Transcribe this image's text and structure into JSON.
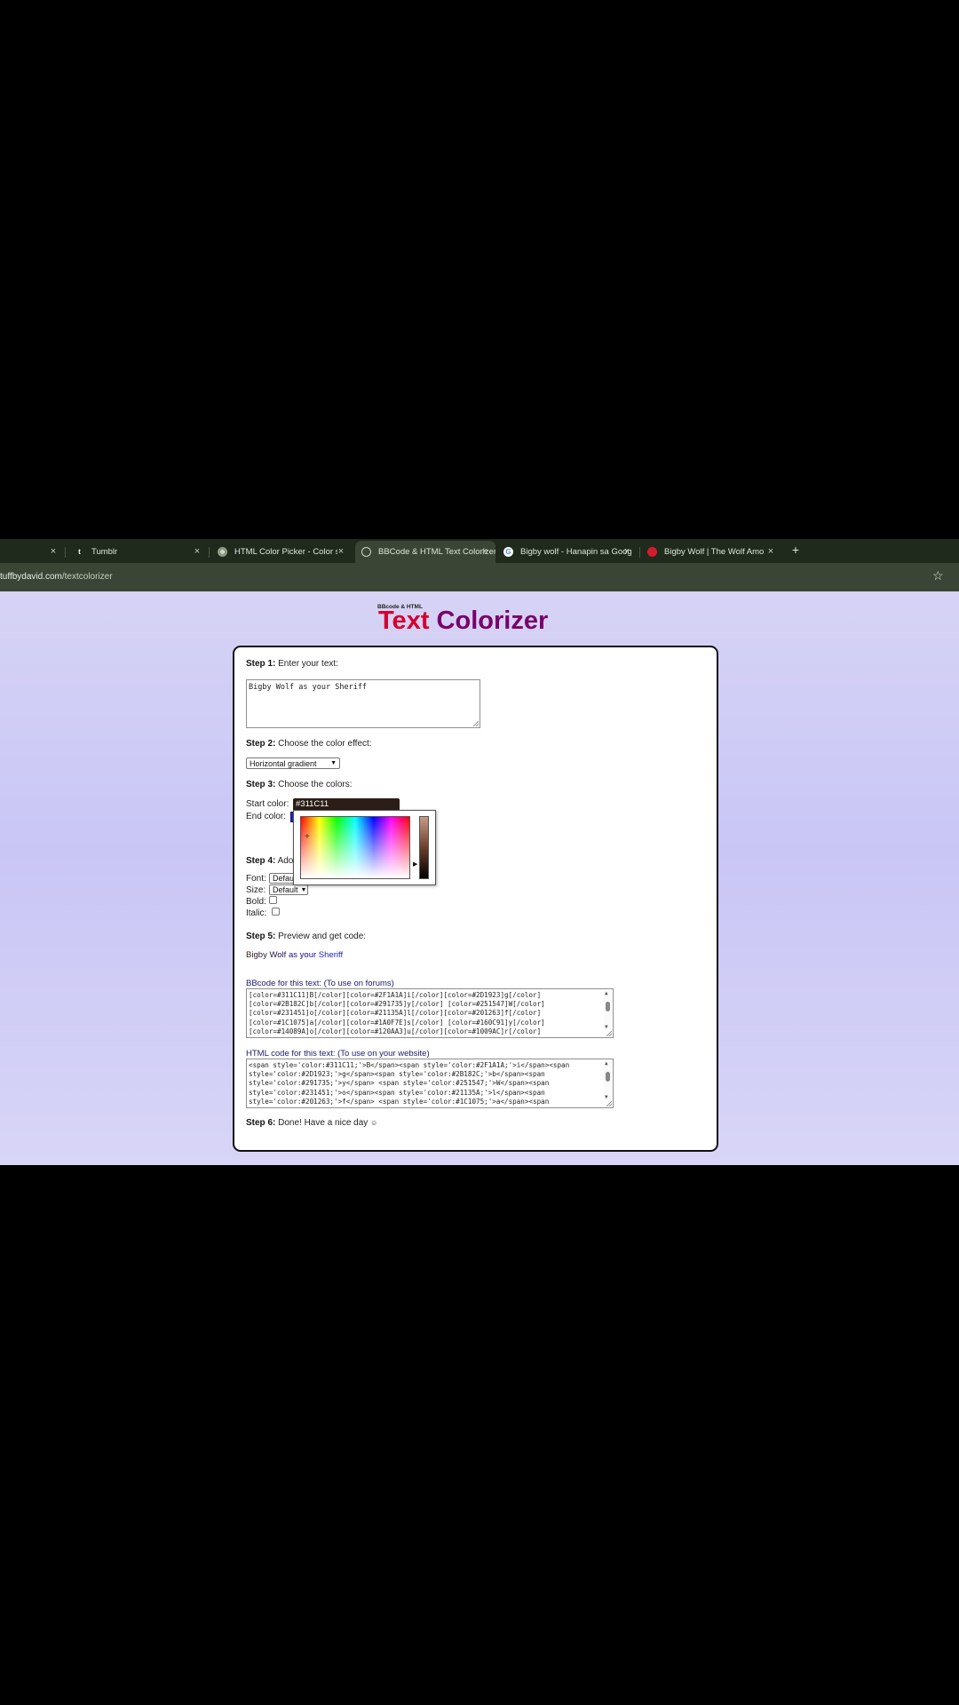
{
  "browser": {
    "tabs": [
      {
        "title": "",
        "favicon": "",
        "active": false
      },
      {
        "title": "Tumblr",
        "favicon": "tumblr-icon",
        "active": false
      },
      {
        "title": "HTML Color Picker - Color selec",
        "favicon": "colorpicker-icon",
        "active": false
      },
      {
        "title": "BBCode & HTML Text Colorizer",
        "favicon": "globe-icon",
        "active": true
      },
      {
        "title": "Bigby wolf - Hanapin sa Google",
        "favicon": "google-icon",
        "active": false
      },
      {
        "title": "Bigby Wolf | The Wolf Among U",
        "favicon": "fandom-icon",
        "active": false
      }
    ],
    "close_glyph": "×",
    "new_tab_glyph": "+",
    "url_host": "tuffbydavid.com",
    "url_path": "/textcolorizer",
    "star_glyph": "☆"
  },
  "logo": {
    "small": "BBcode & HTML",
    "word1": "Text",
    "word2": "Colorizer"
  },
  "step1": {
    "label": "Step 1:",
    "text": "Enter your text:",
    "value": "Bigby Wolf as your Sheriff"
  },
  "step2": {
    "label": "Step 2:",
    "text": "Choose the color effect:",
    "selected": "Horizontal gradient"
  },
  "step3": {
    "label": "Step 3:",
    "text": "Choose the colors:",
    "start_label": "Start color:",
    "start_value": "#311C11",
    "end_label": "End color:",
    "end_value_color": "#1F2AC0"
  },
  "step4": {
    "label": "Step 4:",
    "text": "Ado",
    "font_label": "Font:",
    "font_value": "Defau",
    "size_label": "Size:",
    "size_value": "Default",
    "bold_label": "Bold:",
    "italic_label": "Italic:"
  },
  "step5": {
    "label": "Step 5:",
    "text": "Preview and get code:",
    "preview_chars": [
      {
        "c": "B",
        "color": "#311C11"
      },
      {
        "c": "i",
        "color": "#2F1A1A"
      },
      {
        "c": "g",
        "color": "#2D1923"
      },
      {
        "c": "b",
        "color": "#2B182C"
      },
      {
        "c": "y",
        "color": "#291735"
      },
      {
        "c": " ",
        "color": "#291735"
      },
      {
        "c": "W",
        "color": "#251547"
      },
      {
        "c": "o",
        "color": "#231451"
      },
      {
        "c": "l",
        "color": "#21135A"
      },
      {
        "c": "f",
        "color": "#201263"
      },
      {
        "c": " ",
        "color": "#201263"
      },
      {
        "c": "a",
        "color": "#1C1075"
      },
      {
        "c": "s",
        "color": "#1A0F7E"
      },
      {
        "c": " ",
        "color": "#1A0F7E"
      },
      {
        "c": "y",
        "color": "#160C91"
      },
      {
        "c": "o",
        "color": "#14089A"
      },
      {
        "c": "u",
        "color": "#120AA3"
      },
      {
        "c": "r",
        "color": "#1009AC"
      },
      {
        "c": " ",
        "color": "#1009AC"
      },
      {
        "c": "S",
        "color": "#1A1FB5"
      },
      {
        "c": "h",
        "color": "#1C22B8"
      },
      {
        "c": "e",
        "color": "#1D24BA"
      },
      {
        "c": "r",
        "color": "#1E26BC"
      },
      {
        "c": "i",
        "color": "#1F28BE"
      },
      {
        "c": "f",
        "color": "#1F29BF"
      },
      {
        "c": "f",
        "color": "#1F2AC0"
      }
    ]
  },
  "bbcode": {
    "label": "BBcode for this text: (To use on forums)",
    "lines": [
      "[color=#311C11]B[/color][color=#2F1A1A]i[/color][color=#2D1923]g[/color]",
      "[color=#2B182C]b[/color][color=#291735]y[/color] [color=#251547]W[/color]",
      "[color=#231451]o[/color][color=#21135A]l[/color][color=#201263]f[/color]",
      "[color=#1C1075]a[/color][color=#1A0F7E]s[/color] [color=#160C91]y[/color]",
      "[color=#14089A]o[/color][color=#120AA3]u[/color][color=#1009AC]r[/color]"
    ]
  },
  "html_code": {
    "label": "HTML code for this text: (To use on your website)",
    "lines": [
      "<span style='color:#311C11;'>B</span><span style='color:#2F1A1A;'>i</span><span",
      "style='color:#2D1923;'>g</span><span style='color:#2B182C;'>b</span><span",
      "style='color:#291735;'>y</span> <span style='color:#251547;'>W</span><span",
      "style='color:#231451;'>o</span><span style='color:#21135A;'>l</span><span",
      "style='color:#201263;'>f</span> <span style='color:#1C1075;'>a</span><span"
    ]
  },
  "step6": {
    "label": "Step 6:",
    "text": "Done! Have a nice day",
    "smiley": "☺"
  }
}
